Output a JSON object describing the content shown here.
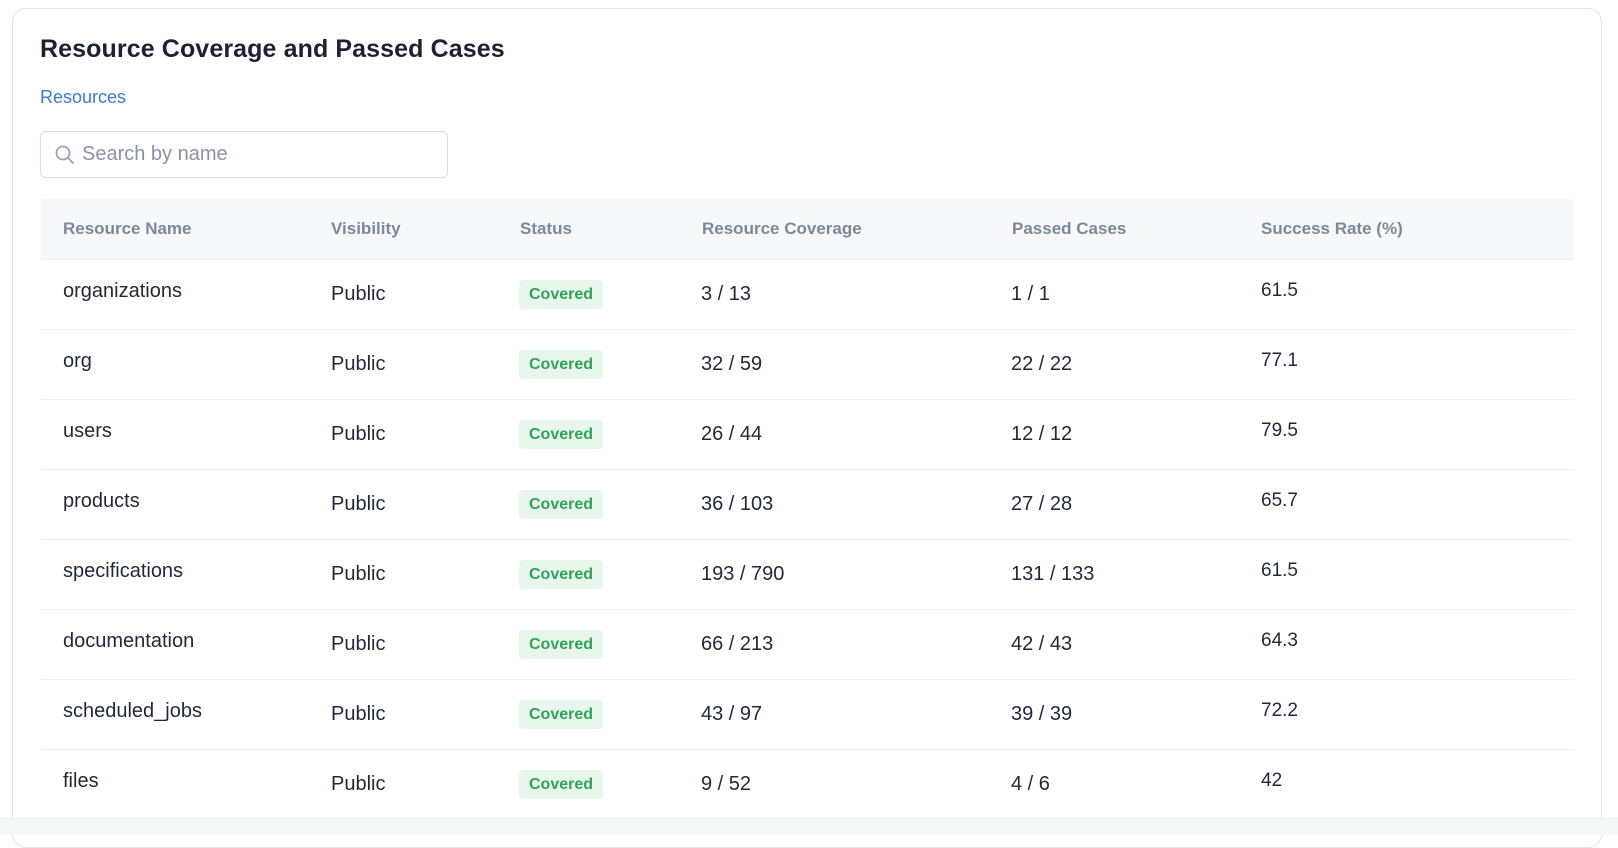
{
  "panel": {
    "title": "Resource Coverage and Passed Cases",
    "link_label": "Resources"
  },
  "search": {
    "placeholder": "Search by name",
    "value": "",
    "icon": "search-icon"
  },
  "table": {
    "columns": [
      "Resource Name",
      "Visibility",
      "Status",
      "Resource Coverage",
      "Passed Cases",
      "Success Rate (%)"
    ],
    "rows": [
      {
        "name": "organizations",
        "visibility": "Public",
        "status": "Covered",
        "coverage": "3 / 13",
        "passed": "1 / 1",
        "rate": "61.5"
      },
      {
        "name": "org",
        "visibility": "Public",
        "status": "Covered",
        "coverage": "32 / 59",
        "passed": "22 / 22",
        "rate": "77.1"
      },
      {
        "name": "users",
        "visibility": "Public",
        "status": "Covered",
        "coverage": "26 / 44",
        "passed": "12 / 12",
        "rate": "79.5"
      },
      {
        "name": "products",
        "visibility": "Public",
        "status": "Covered",
        "coverage": "36 / 103",
        "passed": "27 / 28",
        "rate": "65.7"
      },
      {
        "name": "specifications",
        "visibility": "Public",
        "status": "Covered",
        "coverage": "193 / 790",
        "passed": "131 / 133",
        "rate": "61.5"
      },
      {
        "name": "documentation",
        "visibility": "Public",
        "status": "Covered",
        "coverage": "66 / 213",
        "passed": "42 / 43",
        "rate": "64.3"
      },
      {
        "name": "scheduled_jobs",
        "visibility": "Public",
        "status": "Covered",
        "coverage": "43 / 97",
        "passed": "39 / 39",
        "rate": "72.2"
      },
      {
        "name": "files",
        "visibility": "Public",
        "status": "Covered",
        "coverage": "9 / 52",
        "passed": "4 / 6",
        "rate": "42"
      }
    ]
  },
  "colors": {
    "title": "#1a2233",
    "link": "#3b7bd4",
    "header_text": "#7c889a",
    "badge_bg": "#e8f7ec",
    "badge_text": "#2fa25a",
    "header_bg": "#f6f8fa"
  }
}
